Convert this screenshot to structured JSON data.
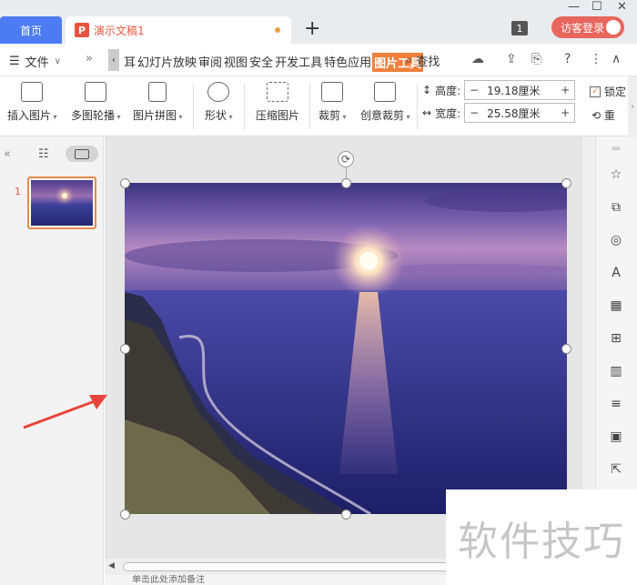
{
  "titlebar": {
    "home_tab": "首页",
    "doc_logo": "P",
    "doc_tab": "演示文稿1",
    "new_tab": "+",
    "page_badge": "1",
    "login_label": "访客登录"
  },
  "menubar": {
    "file_label": "文件",
    "more": "»",
    "tabs": [
      "幻灯片放映",
      "审阅",
      "视图",
      "安全",
      "开发工具",
      "特色应用",
      "图片工具"
    ],
    "tab_prefix": "耳",
    "active_tab": "图片工具",
    "find_label": "查找"
  },
  "ribbon": {
    "insert_image": "插入图片",
    "multi_carousel": "多图轮播",
    "image_collage": "图片拼图",
    "shape": "形状",
    "compress": "压缩图片",
    "crop": "裁剪",
    "creative_crop": "创意裁剪",
    "height_label": "高度:",
    "height_value": "19.18厘米",
    "width_label": "宽度:",
    "width_value": "25.58厘米",
    "lock_label": "锁定",
    "reset_label": "重"
  },
  "left_panel": {
    "slide_number": "1"
  },
  "notes": {
    "placeholder": "单击此处添加备注"
  },
  "watermark": "软件技巧",
  "colors": {
    "accent": "#4d7bf3",
    "active_tab": "#f0803c",
    "brand_red": "#e8553e",
    "login": "#e7665d",
    "annotation_arrow": "#e8453a"
  }
}
